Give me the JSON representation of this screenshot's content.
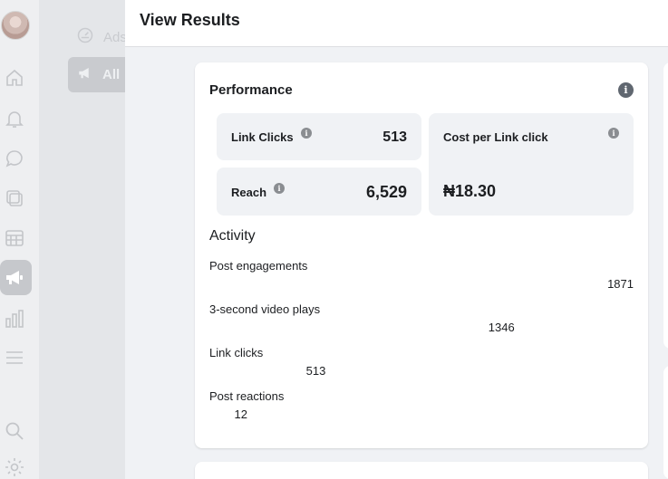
{
  "modal": {
    "title": "View Results"
  },
  "background": {
    "ads_label": "Ads",
    "all_label": "All"
  },
  "performance": {
    "title": "Performance",
    "metrics": [
      {
        "label": "Link Clicks",
        "value": "513"
      },
      {
        "label": "Cost per Link click",
        "value": ""
      },
      {
        "label": "Reach",
        "value": "6,529"
      },
      {
        "label": "",
        "value": "₦18.30"
      }
    ]
  },
  "activity": {
    "title": "Activity",
    "max_value": 1871,
    "items": [
      {
        "label": "Post engagements",
        "value": 1871
      },
      {
        "label": "3-second video plays",
        "value": 1346
      },
      {
        "label": "Link clicks",
        "value": 513
      },
      {
        "label": "Post reactions",
        "value": 12
      }
    ]
  },
  "icons": {
    "rail": [
      "home-icon",
      "bell-icon",
      "chat-icon",
      "pages-icon",
      "calendar-icon",
      "megaphone-icon",
      "insights-icon",
      "menu-icon",
      "search-icon",
      "settings-icon"
    ]
  }
}
